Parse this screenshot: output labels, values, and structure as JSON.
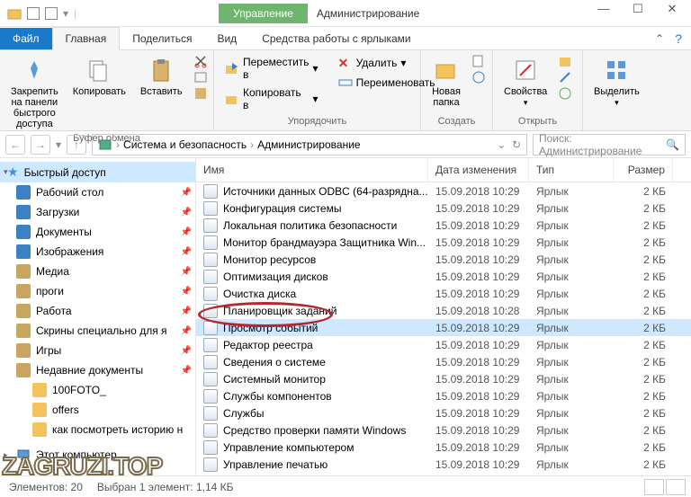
{
  "titlebar": {
    "context_tab": "Управление",
    "title": "Администрирование"
  },
  "tabs": {
    "file": "Файл",
    "home": "Главная",
    "share": "Поделиться",
    "view": "Вид",
    "tools": "Средства работы с ярлыками"
  },
  "ribbon": {
    "pin": "Закрепить на панели\nбыстрого доступа",
    "copy": "Копировать",
    "paste": "Вставить",
    "group_clipboard": "Буфер обмена",
    "move_to": "Переместить в",
    "copy_to": "Копировать в",
    "delete": "Удалить",
    "rename": "Переименовать",
    "group_organize": "Упорядочить",
    "new_folder": "Новая\nпапка",
    "group_new": "Создать",
    "properties": "Свойства",
    "group_open": "Открыть",
    "select": "Выделить"
  },
  "address": {
    "crumb1": "Система и безопасность",
    "crumb2": "Администрирование"
  },
  "search": {
    "placeholder": "Поиск: Администрирование"
  },
  "tree": {
    "quick": "Быстрый доступ",
    "items": [
      {
        "label": "Рабочий стол",
        "color": "#3b82c4"
      },
      {
        "label": "Загрузки",
        "color": "#3b82c4"
      },
      {
        "label": "Документы",
        "color": "#3b82c4"
      },
      {
        "label": "Изображения",
        "color": "#3b82c4"
      },
      {
        "label": "Медиа",
        "color": "#caa560"
      },
      {
        "label": "проги",
        "color": "#caa560"
      },
      {
        "label": "Работа",
        "color": "#caa560"
      },
      {
        "label": "Скрины специально для я",
        "color": "#caa560"
      },
      {
        "label": "Игры",
        "color": "#caa560"
      },
      {
        "label": "Недавние документы",
        "color": "#caa560"
      }
    ],
    "sub": [
      {
        "label": "100FOTO_"
      },
      {
        "label": "offers"
      },
      {
        "label": "как посмотреть историю н"
      }
    ],
    "computer": "Этот компьютер"
  },
  "columns": {
    "name": "Имя",
    "date": "Дата изменения",
    "type": "Тип",
    "size": "Размер"
  },
  "files": [
    {
      "name": "Источники данных ODBC (64-разрядна...",
      "date": "15.09.2018 10:29",
      "type": "Ярлык",
      "size": "2 КБ"
    },
    {
      "name": "Конфигурация системы",
      "date": "15.09.2018 10:29",
      "type": "Ярлык",
      "size": "2 КБ"
    },
    {
      "name": "Локальная политика безопасности",
      "date": "15.09.2018 10:29",
      "type": "Ярлык",
      "size": "2 КБ"
    },
    {
      "name": "Монитор брандмауэра Защитника Win...",
      "date": "15.09.2018 10:29",
      "type": "Ярлык",
      "size": "2 КБ"
    },
    {
      "name": "Монитор ресурсов",
      "date": "15.09.2018 10:29",
      "type": "Ярлык",
      "size": "2 КБ"
    },
    {
      "name": "Оптимизация дисков",
      "date": "15.09.2018 10:29",
      "type": "Ярлык",
      "size": "2 КБ"
    },
    {
      "name": "Очистка диска",
      "date": "15.09.2018 10:29",
      "type": "Ярлык",
      "size": "2 КБ"
    },
    {
      "name": "Планировщик заданий",
      "date": "15.09.2018 10:28",
      "type": "Ярлык",
      "size": "2 КБ"
    },
    {
      "name": "Просмотр событий",
      "date": "15.09.2018 10:29",
      "type": "Ярлык",
      "size": "2 КБ",
      "selected": true
    },
    {
      "name": "Редактор реестра",
      "date": "15.09.2018 10:29",
      "type": "Ярлык",
      "size": "2 КБ"
    },
    {
      "name": "Сведения о системе",
      "date": "15.09.2018 10:29",
      "type": "Ярлык",
      "size": "2 КБ"
    },
    {
      "name": "Системный монитор",
      "date": "15.09.2018 10:29",
      "type": "Ярлык",
      "size": "2 КБ"
    },
    {
      "name": "Службы компонентов",
      "date": "15.09.2018 10:29",
      "type": "Ярлык",
      "size": "2 КБ"
    },
    {
      "name": "Службы",
      "date": "15.09.2018 10:29",
      "type": "Ярлык",
      "size": "2 КБ"
    },
    {
      "name": "Средство проверки памяти Windows",
      "date": "15.09.2018 10:29",
      "type": "Ярлык",
      "size": "2 КБ"
    },
    {
      "name": "Управление компьютером",
      "date": "15.09.2018 10:29",
      "type": "Ярлык",
      "size": "2 КБ"
    },
    {
      "name": "Управление печатью",
      "date": "15.09.2018 10:29",
      "type": "Ярлык",
      "size": "2 КБ"
    }
  ],
  "status": {
    "count": "Элементов: 20",
    "selection": "Выбран 1 элемент: 1,14 КБ"
  },
  "watermark": "ZAGRUZI.TOP"
}
